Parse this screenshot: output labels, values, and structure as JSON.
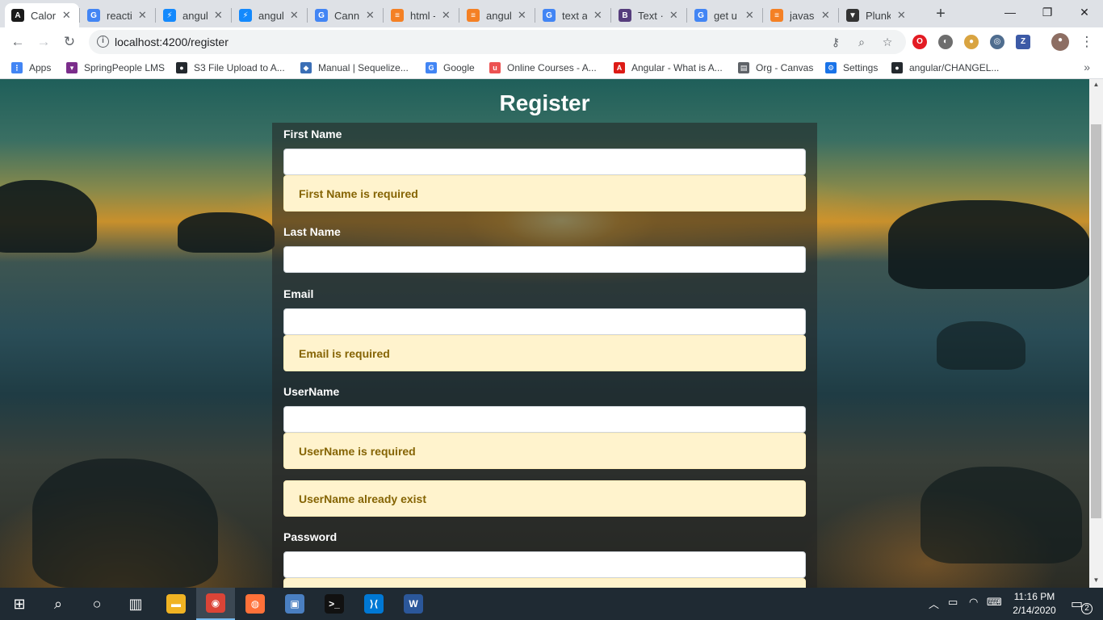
{
  "browser": {
    "tabs": [
      {
        "title": "Calori",
        "icon": "angular-icon",
        "color": "#1a1a1a",
        "glyph": "A"
      },
      {
        "title": "reacti",
        "icon": "google-icon",
        "color": "#4285f4",
        "glyph": "G"
      },
      {
        "title": "angul",
        "icon": "stackblitz-icon",
        "color": "#1389fd",
        "glyph": "⚡"
      },
      {
        "title": "angul",
        "icon": "stackblitz-icon",
        "color": "#1389fd",
        "glyph": "⚡"
      },
      {
        "title": "Canno",
        "icon": "google-icon",
        "color": "#4285f4",
        "glyph": "G"
      },
      {
        "title": "html -",
        "icon": "stackoverflow-icon",
        "color": "#f48024",
        "glyph": "≡"
      },
      {
        "title": "angul",
        "icon": "stackoverflow-icon",
        "color": "#f48024",
        "glyph": "≡"
      },
      {
        "title": "text a",
        "icon": "google-icon",
        "color": "#4285f4",
        "glyph": "G"
      },
      {
        "title": "Text ·",
        "icon": "bootstrap-icon",
        "color": "#563d7c",
        "glyph": "B"
      },
      {
        "title": "get u",
        "icon": "google-icon",
        "color": "#4285f4",
        "glyph": "G"
      },
      {
        "title": "javasc",
        "icon": "stackoverflow-icon",
        "color": "#f48024",
        "glyph": "≡"
      },
      {
        "title": "Plunk",
        "icon": "plunker-icon",
        "color": "#333333",
        "glyph": "▼"
      }
    ],
    "new_tab": "+",
    "window": {
      "minimize": "—",
      "maximize": "❐",
      "close": "✕"
    },
    "url": "localhost:4200/register",
    "bookmarks": [
      {
        "label": "Apps",
        "icon": "apps-grid-icon",
        "color": "#4285f4",
        "glyph": "⋮"
      },
      {
        "label": "SpringPeople LMS",
        "icon": "springpeople-icon",
        "color": "#7b2d8b",
        "glyph": "▾"
      },
      {
        "label": "S3 File Upload to A...",
        "icon": "github-icon",
        "color": "#24292e",
        "glyph": "●"
      },
      {
        "label": "Manual | Sequelize...",
        "icon": "sequelize-icon",
        "color": "#3b6fb6",
        "glyph": "◆"
      },
      {
        "label": "Google",
        "icon": "google-icon",
        "color": "#4285f4",
        "glyph": "G"
      },
      {
        "label": "Online Courses - A...",
        "icon": "udemy-icon",
        "color": "#ec5252",
        "glyph": "u"
      },
      {
        "label": "Angular - What is A...",
        "icon": "angular-icon",
        "color": "#dd1b16",
        "glyph": "A"
      },
      {
        "label": "Org - Canvas",
        "icon": "document-icon",
        "color": "#5f6368",
        "glyph": "▤"
      },
      {
        "label": "Settings",
        "icon": "gear-icon",
        "color": "#1a73e8",
        "glyph": "⚙"
      },
      {
        "label": "angular/CHANGEL...",
        "icon": "github-icon",
        "color": "#24292e",
        "glyph": "●"
      }
    ],
    "bookmarks_more": "»"
  },
  "page": {
    "title": "Register",
    "fields": {
      "first_name_label": "First Name",
      "first_name_alert": "First Name is required",
      "last_name_label": "Last Name",
      "email_label": "Email",
      "email_alert": "Email is required",
      "username_label": "UserName",
      "username_alert_required": "UserName is required",
      "username_alert_exists": "UserName already exist",
      "password_label": "Password"
    }
  },
  "taskbar": {
    "apps": [
      {
        "name": "file-explorer",
        "color": "#f0b323",
        "glyph": "▬"
      },
      {
        "name": "chrome",
        "color": "#db4437",
        "glyph": "◉"
      },
      {
        "name": "firefox",
        "color": "#ff7139",
        "glyph": "◍"
      },
      {
        "name": "remote-desktop",
        "color": "#4a7fc1",
        "glyph": "▣"
      },
      {
        "name": "terminal",
        "color": "#111111",
        "glyph": ">_"
      },
      {
        "name": "vscode",
        "color": "#0078d4",
        "glyph": "⟩⟨"
      },
      {
        "name": "word",
        "color": "#2b579a",
        "glyph": "W"
      }
    ],
    "time": "11:16 PM",
    "date": "2/14/2020",
    "notifications": "2"
  }
}
